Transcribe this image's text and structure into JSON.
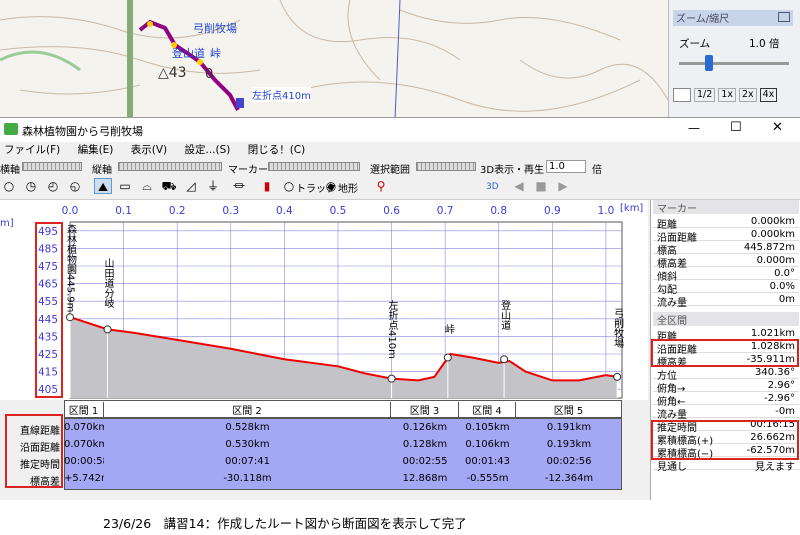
{
  "map": {
    "labels": {
      "ranch": "弓削牧場",
      "trail": "登山道",
      "pass": "峠",
      "peak_num": "△43",
      "peak_zero": "0",
      "turn": "左折点410m"
    }
  },
  "zoom_panel": {
    "title": "ズーム/縮尺",
    "zoom_label": "ズーム",
    "zoom_value": "1.0 倍",
    "buttons": [
      "1/2",
      "1x",
      "2x",
      "4x"
    ]
  },
  "window": {
    "title": "森林植物園から弓削牧場",
    "controls": {
      "min": "—",
      "max": "☐",
      "close": "✕"
    }
  },
  "menu": [
    "ファイル(F)",
    "編集(E)",
    "表示(V)",
    "設定...(S)",
    "閉じる！(C)"
  ],
  "toolbar": {
    "horizontal_axis": "横軸",
    "vertical_axis": "縦軸",
    "marker": "マーカー",
    "track": "トラック",
    "terrain": "地形",
    "selection": "選択範囲",
    "view3d_label": "3D表示・再生",
    "speed": "1.0",
    "speed_unit": "倍",
    "btn3d": "3D"
  },
  "chart_data": {
    "type": "line",
    "x_unit": "[km]",
    "xlabel": "",
    "ylabel": "",
    "x_ticks": [
      "0.0",
      "0.1",
      "0.2",
      "0.3",
      "0.4",
      "0.5",
      "0.6",
      "0.7",
      "0.8",
      "0.9",
      "1.0"
    ],
    "y_unit": "m]",
    "y_ticks": [
      "495",
      "485",
      "475",
      "465",
      "455",
      "445",
      "435",
      "425",
      "415",
      "405"
    ],
    "xlim": [
      0,
      1.03
    ],
    "ylim": [
      400,
      500
    ],
    "series": [
      {
        "x": [
          0,
          0.01,
          0.07,
          0.12,
          0.2,
          0.3,
          0.4,
          0.5,
          0.55,
          0.6,
          0.65,
          0.68,
          0.71,
          0.75,
          0.8,
          0.82,
          0.85,
          0.9,
          0.95,
          1.0,
          1.021
        ],
        "y": [
          445.9,
          445,
          439,
          437,
          433,
          428,
          422,
          418,
          414,
          411,
          410,
          412,
          425,
          423,
          420,
          421,
          415,
          410,
          410,
          413,
          412
        ]
      }
    ],
    "waypoints": [
      {
        "x": 0,
        "y": 445.9,
        "label": "森林植物園445.9m"
      },
      {
        "x": 0.07,
        "y": 439,
        "label": "山田道分岐"
      },
      {
        "x": 0.6,
        "y": 411,
        "label": "左折点410m"
      },
      {
        "x": 0.705,
        "y": 423,
        "label": "峠"
      },
      {
        "x": 0.81,
        "y": 422,
        "label": "登山道"
      },
      {
        "x": 1.021,
        "y": 412,
        "label": "弓削牧場"
      }
    ]
  },
  "section_table": {
    "row_labels": [
      "直線距離",
      "沿面距離",
      "推定時間",
      "標高差"
    ],
    "sections": [
      {
        "name": "区間 1",
        "values": [
          "0.070km",
          "0.070km",
          "00:00:58",
          "+5.742m"
        ]
      },
      {
        "name": "区間 2",
        "values": [
          "0.528km",
          "0.530km",
          "00:07:41",
          "-30.118m"
        ]
      },
      {
        "name": "区間 3",
        "values": [
          "0.126km",
          "0.128km",
          "00:02:55",
          "12.868m"
        ]
      },
      {
        "name": "区間 4",
        "values": [
          "0.105km",
          "0.106km",
          "00:01:43",
          "-0.555m"
        ]
      },
      {
        "name": "区間 5",
        "values": [
          "0.191km",
          "0.193km",
          "00:02:56",
          "-12.364m"
        ]
      }
    ]
  },
  "marker_panel": {
    "title": "マーカー",
    "rows": [
      [
        "距離",
        "0.000km"
      ],
      [
        "沿面距離",
        "0.000km"
      ],
      [
        "標高",
        "445.872m"
      ],
      [
        "標高差",
        "0.000m"
      ],
      [
        "傾斜",
        "0.0°"
      ],
      [
        "勾配",
        "0.0%"
      ],
      [
        "流み量",
        "0m"
      ]
    ],
    "section_title": "全区間",
    "all_rows": [
      [
        "距離",
        "1.021km"
      ],
      [
        "沿面距離",
        "1.028km"
      ],
      [
        "標高差",
        "-35.911m"
      ],
      [
        "方位",
        "340.36°"
      ],
      [
        "俯角→",
        "2.96°"
      ],
      [
        "俯角←",
        "-2.96°"
      ],
      [
        "流み量",
        "-0m"
      ],
      [
        "推定時間",
        "00:16:15"
      ],
      [
        "累積標高(+)",
        "26.662m"
      ],
      [
        "累積標高(−)",
        "-62.570m"
      ],
      [
        "見通し",
        "見えます"
      ]
    ]
  },
  "caption": "23/6/26　講習14：作成したルート図から断面図を表示して完了"
}
